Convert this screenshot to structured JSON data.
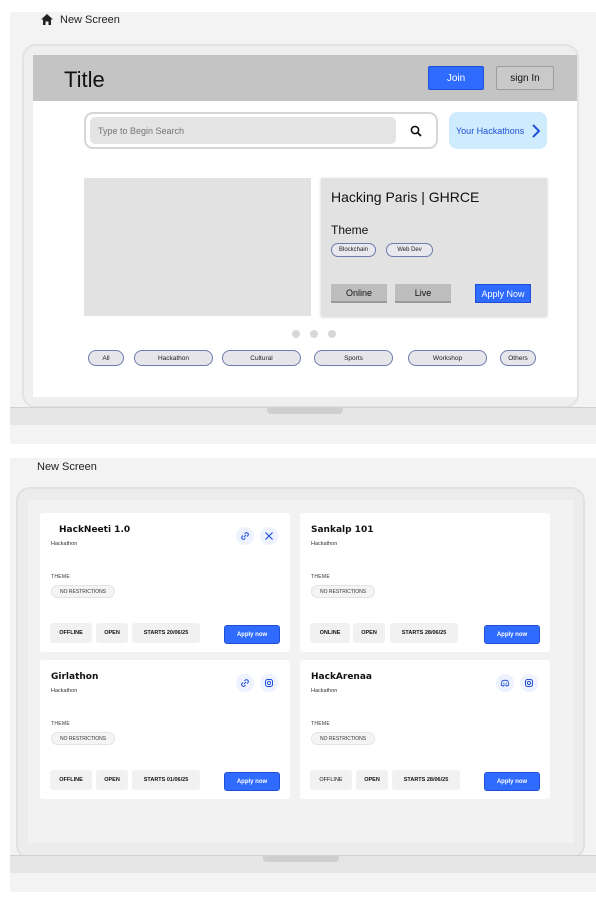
{
  "screen1": {
    "label": "New Screen",
    "title": "Title",
    "join": "Join",
    "sign_in": "sign In",
    "search_placeholder": "Type to Begin Search",
    "your_hackathons": "Your Hackathons",
    "featured": {
      "name": "Hacking Paris | GHRCE",
      "theme_label": "Theme",
      "tags": [
        "Blockchain",
        "Web Dev"
      ],
      "modes": [
        "Online",
        "Live"
      ],
      "apply": "Apply Now"
    },
    "categories": [
      "All",
      "Hackathon",
      "Cultural",
      "Sports",
      "Workshop",
      "Others"
    ]
  },
  "screen2": {
    "label": "New Screen",
    "cards": [
      {
        "name": "HackNeeti 1.0",
        "type": "Hackathon",
        "theme_label": "THEME",
        "theme": "NO RESTRICTIONS",
        "mode": "OFFLINE",
        "status": "OPEN",
        "starts": "STARTS 20/06/25",
        "apply": "Apply now",
        "icons": [
          "link-icon",
          "x-icon"
        ]
      },
      {
        "name": "Sankalp 101",
        "type": "Hackathon",
        "theme_label": "THEME",
        "theme": "NO RESTRICTIONS",
        "mode": "ONLINE",
        "status": "OPEN",
        "starts": "STARTS 28/06/25",
        "apply": "Apply now",
        "icons": []
      },
      {
        "name": "Girlathon",
        "type": "Hackathon",
        "theme_label": "THEME",
        "theme": "NO RESTRICTIONS",
        "mode": "OFFLINE",
        "status": "OPEN",
        "starts": "STARTS 01/06/25",
        "apply": "Apply now",
        "icons": [
          "link-icon",
          "instagram-icon"
        ]
      },
      {
        "name": "HackArenaa",
        "type": "Hackathon",
        "theme_label": "THEME",
        "theme": "NO RESTRICTIONS",
        "mode": "OFFLINE",
        "status": "OPEN",
        "starts": "STARTS 28/06/25",
        "apply": "Apply now",
        "icons": [
          "discord-icon",
          "instagram-icon"
        ]
      }
    ]
  },
  "colors": {
    "primary": "#2f6bff",
    "header_gray": "#c4c4c4",
    "light_blue": "#cfecff"
  }
}
